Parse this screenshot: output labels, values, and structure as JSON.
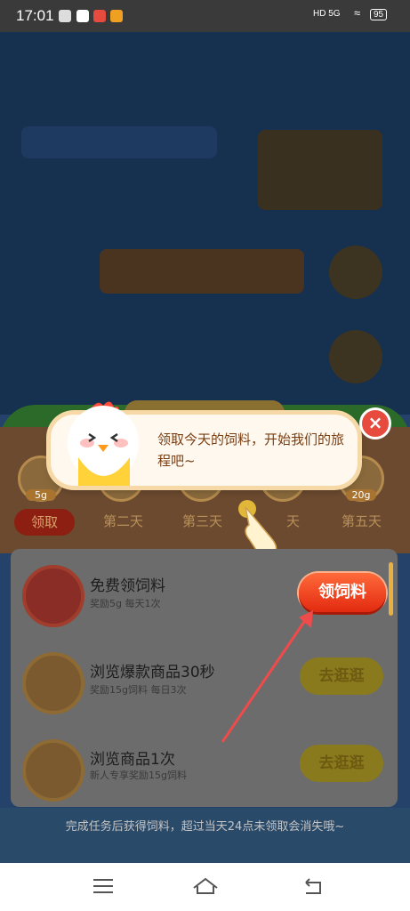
{
  "status_bar": {
    "time": "17:01",
    "network": "HD 5G",
    "battery": "95"
  },
  "popup": {
    "message": "领取今天的饲料，开始我们的旅程吧~",
    "close_symbol": "×"
  },
  "days": {
    "first_label": "领取",
    "feed_amounts": [
      "5g",
      "",
      "",
      "",
      "20g"
    ],
    "labels": [
      "第二天",
      "第三天",
      "天",
      "第五天"
    ]
  },
  "tasks": [
    {
      "title": "免费领饲料",
      "sub": "奖励5g   每天1次",
      "button": "领饲料"
    },
    {
      "title": "浏览爆款商品30秒",
      "sub": "奖励15g饲料   每日3次",
      "button": "去逛逛"
    },
    {
      "title": "浏览商品1次",
      "sub": "新人专享奖励15g饲料",
      "button": "去逛逛"
    }
  ],
  "footer_text": "完成任务后获得饲料，超过当天24点未领取会消失哦~",
  "colors": {
    "accent": "#e22a10",
    "bubble": "#fff8ee",
    "arrow": "#ef4b4b"
  },
  "nav": {
    "icons": [
      "menu-icon",
      "home-icon",
      "back-icon"
    ]
  }
}
